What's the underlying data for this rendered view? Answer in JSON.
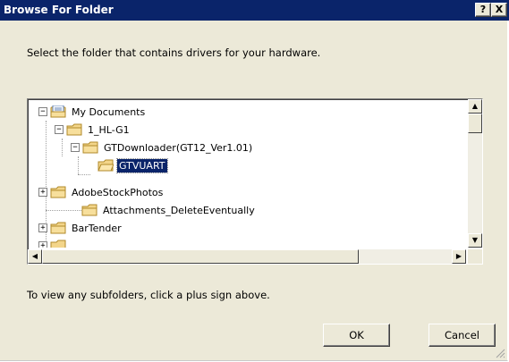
{
  "window": {
    "title": "Browse For Folder",
    "help_button": "?",
    "close_button": "X"
  },
  "instruction": "Select the folder that contains drivers for your hardware.",
  "tree": {
    "items": [
      {
        "label": "My Documents",
        "expander": "−",
        "icon": "documents-folder-icon",
        "selected": false
      },
      {
        "label": "1_HL-G1",
        "expander": "−",
        "icon": "folder-icon",
        "selected": false
      },
      {
        "label": "GTDownloader(GT12_Ver1.01)",
        "expander": "−",
        "icon": "folder-icon",
        "selected": false
      },
      {
        "label": "GTVUART",
        "expander": "",
        "icon": "folder-open-icon",
        "selected": true
      },
      {
        "label": "AdobeStockPhotos",
        "expander": "+",
        "icon": "folder-icon",
        "selected": false
      },
      {
        "label": "Attachments_DeleteEventually",
        "expander": "",
        "icon": "folder-icon",
        "selected": false
      },
      {
        "label": "BarTender",
        "expander": "+",
        "icon": "folder-icon",
        "selected": false
      }
    ]
  },
  "hint": "To view any subfolders, click a plus sign above.",
  "buttons": {
    "ok": "OK",
    "cancel": "Cancel"
  },
  "colors": {
    "titlebar": "#0a246a",
    "dialog_bg": "#ece9d8",
    "selection": "#0a246a"
  }
}
